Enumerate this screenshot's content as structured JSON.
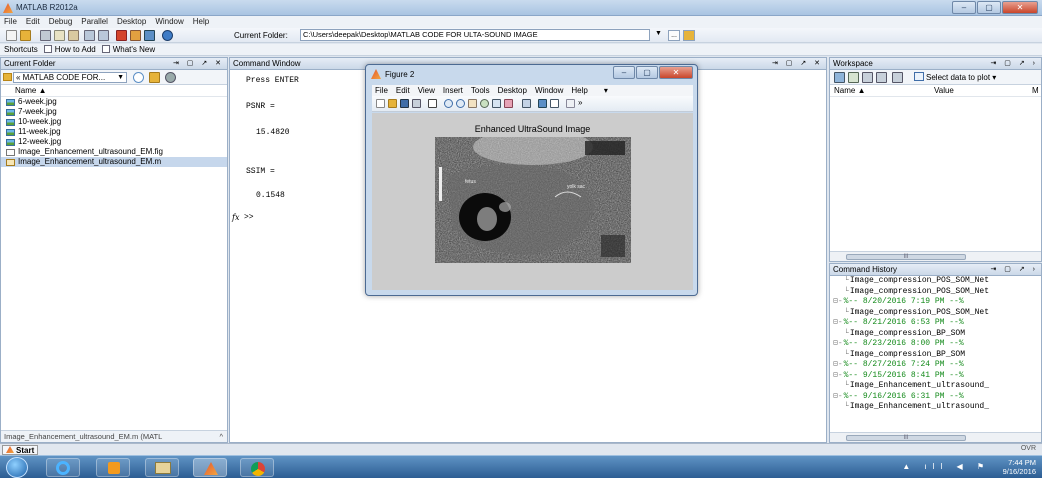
{
  "window": {
    "title": "MATLAB  R2012a",
    "minimize": "–",
    "maximize": "▢",
    "close": "✕"
  },
  "menu": [
    "File",
    "Edit",
    "Debug",
    "Parallel",
    "Desktop",
    "Window",
    "Help"
  ],
  "toolbar": {
    "current_folder_label": "Current Folder:",
    "current_folder_path": "C:\\Users\\deepak\\Desktop\\MATLAB CODE FOR ULTA-SOUND IMAGE",
    "dropdown": "▼",
    "browse": "...",
    "up": "⬆"
  },
  "shortcuts": {
    "items": [
      "Shortcuts",
      "How to Add",
      "What's New"
    ]
  },
  "current_folder": {
    "title": "Current Folder",
    "controls": "⇥ ▢ ↗ ✕",
    "combo": "« MATLAB CODE FOR...",
    "combo_arrow": "▼",
    "name_header": "Name ▲",
    "files": [
      {
        "name": "6-week.jpg",
        "type": "jpg"
      },
      {
        "name": "7-week.jpg",
        "type": "jpg"
      },
      {
        "name": "10-week.jpg",
        "type": "jpg"
      },
      {
        "name": "11-week.jpg",
        "type": "jpg"
      },
      {
        "name": "12-week.jpg",
        "type": "jpg"
      },
      {
        "name": "Image_Enhancement_ultrasound_EM.fig",
        "type": "fig"
      },
      {
        "name": "Image_Enhancement_ultrasound_EM.m",
        "type": "m"
      }
    ],
    "footer": "Image_Enhancement_ultrasound_EM.m (MATL",
    "footer_arrow": "^"
  },
  "command_window": {
    "title": "Command Window",
    "controls": "⇥ ▢ ↗ ✕",
    "lines": [
      "Press ENTER",
      "PSNR =",
      "15.4820",
      "SSIM =",
      "0.1548"
    ],
    "prompt_fx": "fx",
    "prompt": ">>"
  },
  "figure": {
    "title": "Figure 2",
    "menu": [
      "File",
      "Edit",
      "View",
      "Insert",
      "Tools",
      "Desktop",
      "Window",
      "Help"
    ],
    "menu_arrow": "▾",
    "toolbar_more": "»",
    "axes_title": "Enhanced UltraSound Image",
    "image_labels": {
      "left": "fetus",
      "right": "yolk sac"
    }
  },
  "workspace": {
    "title": "Workspace",
    "controls": "⇥ ▢ ↗ ›",
    "select_data": "Select data to plot",
    "select_arrow": "▾",
    "columns": [
      "Name ▲",
      "Value",
      "M"
    ],
    "scroll_marker": "III"
  },
  "command_history": {
    "title": "Command History",
    "controls": "⇥ ▢ ↗ ›",
    "lines": [
      {
        "text": "Image_compression_POS_SOM_Net",
        "session": false
      },
      {
        "text": "Image_compression_POS_SOM_Net",
        "session": false
      },
      {
        "text": "%-- 8/20/2016 7:19 PM --%",
        "session": true
      },
      {
        "text": "Image_compression_POS_SOM_Net",
        "session": false
      },
      {
        "text": "%-- 8/21/2016 6:53 PM --%",
        "session": true
      },
      {
        "text": "Image_compression_BP_SOM",
        "session": false
      },
      {
        "text": "%-- 8/23/2016 8:00 PM --%",
        "session": true
      },
      {
        "text": "Image_compression_BP_SOM",
        "session": false
      },
      {
        "text": "%-- 8/27/2016 7:24 PM --%",
        "session": true
      },
      {
        "text": "%-- 9/15/2016 8:41 PM --%",
        "session": true
      },
      {
        "text": "Image_Enhancement_ultrasound_",
        "session": false
      },
      {
        "text": "%-- 9/16/2016 6:31 PM --%",
        "session": true
      },
      {
        "text": "Image_Enhancement_ultrasound_",
        "session": false
      }
    ],
    "scroll_marker": "III"
  },
  "statusbar": {
    "start": "Start",
    "ovr": "OVR"
  },
  "taskbar": {
    "time": "7:44 PM",
    "date": "9/16/2016",
    "tray_icons": "▲ ıll ◀ ⚑"
  },
  "colors": {
    "session_green": "#138a1a",
    "taskbar_blue": "#2c5d93",
    "selection": "#c6d7ec"
  }
}
